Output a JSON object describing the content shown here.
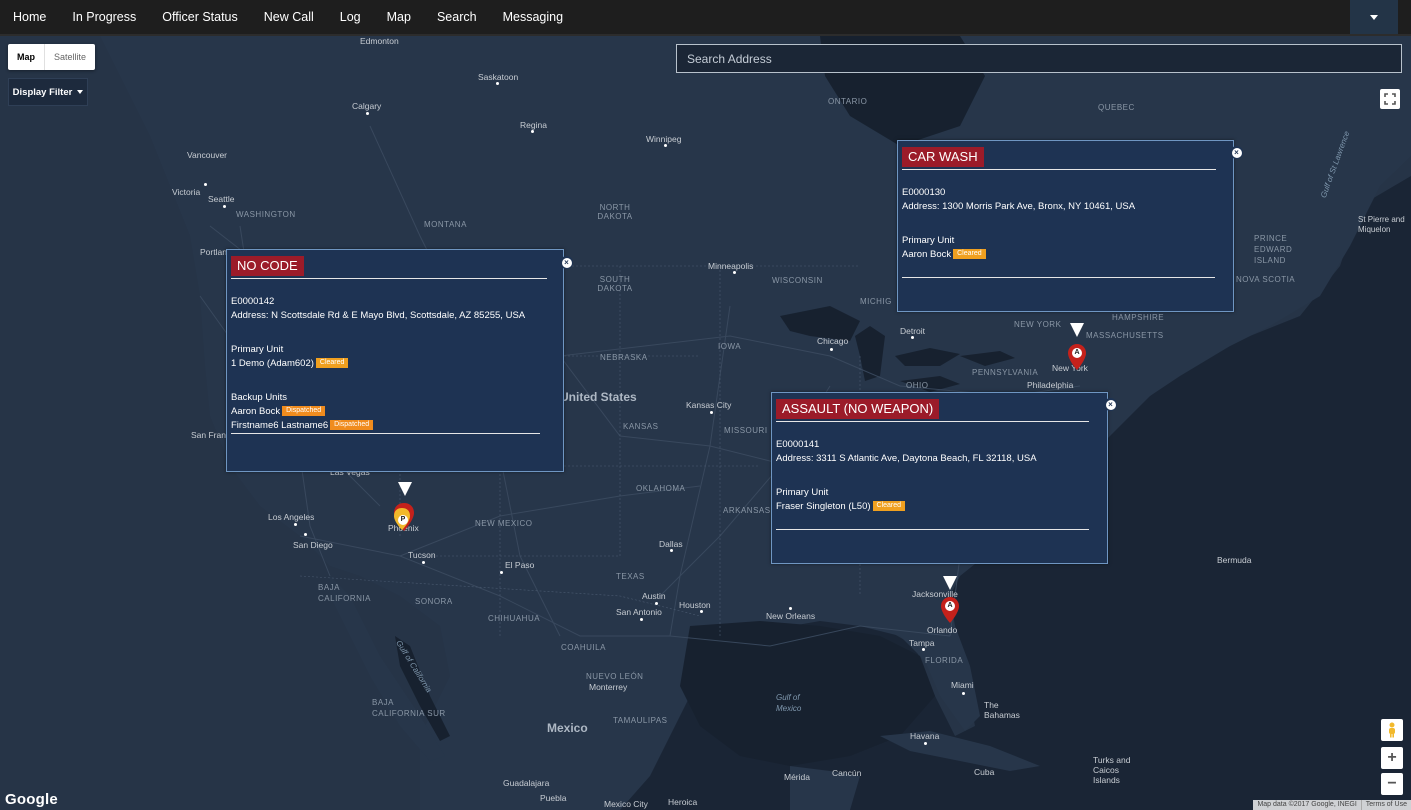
{
  "nav": {
    "items": [
      "Home",
      "In Progress",
      "Officer Status",
      "New Call",
      "Log",
      "Map",
      "Search",
      "Messaging"
    ]
  },
  "map_controls": {
    "map_type_map": "Map",
    "map_type_satellite": "Satellite",
    "display_filter": "Display Filter",
    "search_placeholder": "Search Address",
    "google_logo": "Google",
    "attribution_data": "Map data ©2017 Google, INEGI",
    "attribution_terms": "Terms of Use",
    "zoom_in": "+",
    "zoom_out": "−"
  },
  "popups": {
    "no_code": {
      "title": "NO CODE",
      "event_id": "E0000142",
      "address": "Address: N Scottsdale Rd & E Mayo Blvd, Scottsdale, AZ 85255, USA",
      "primary_label": "Primary Unit",
      "primary_unit": "1 Demo (Adam602)",
      "primary_status": "Cleared",
      "backup_label": "Backup Units",
      "backup_1": "Aaron Bock",
      "backup_1_status": "Dispatched",
      "backup_2": "Firstname6 Lastname6",
      "backup_2_status": "Dispatched"
    },
    "car_wash": {
      "title": "CAR WASH",
      "event_id": "E0000130",
      "address": "Address: 1300 Morris Park Ave, Bronx, NY 10461, USA",
      "primary_label": "Primary Unit",
      "primary_unit": "Aaron Bock",
      "primary_status": "Cleared"
    },
    "assault": {
      "title": "ASSAULT (NO WEAPON)",
      "event_id": "E0000141",
      "address": "Address: 3311 S Atlantic Ave, Daytona Beach, FL 32118, USA",
      "primary_label": "Primary Unit",
      "primary_unit": "Fraser Singleton (L50)",
      "primary_status": "Cleared"
    }
  },
  "markers": {
    "phoenix": "P",
    "new_york": "A",
    "orlando": "A"
  },
  "map_labels": {
    "edmonton": "Edmonton",
    "saskatoon": "Saskatoon",
    "calgary": "Calgary",
    "regina": "Regina",
    "winnipeg": "Winnipeg",
    "ontario": "ONTARIO",
    "quebec": "QUEBEC",
    "vancouver": "Vancouver",
    "victoria": "Victoria",
    "seattle": "Seattle",
    "washington": "WASHINGTON",
    "portland": "Portland",
    "montana": "MONTANA",
    "north_dakota": "NORTH\nDAKOTA",
    "minneapolis": "Minneapolis",
    "south_dakota": "SOUTH\nDAKOTA",
    "wisconsin": "WISCONSIN",
    "michigan": "MICHIG",
    "detroit": "Detroit",
    "chicago": "Chicago",
    "iowa": "IOWA",
    "nebraska": "NEBRASKA",
    "united_states": "United States",
    "kansas_city": "Kansas City",
    "kansas": "KANSAS",
    "missouri": "MISSOURI",
    "oklahoma": "OKLAHOMA",
    "arkansas": "ARKANSAS",
    "new_york_state": "NEW YORK",
    "new_york_city": "New York",
    "pennsylvania": "PENNSYLVANIA",
    "philadelphia": "Philadelphia",
    "ohio": "OHIO",
    "massachusetts": "MASSACHUSETTS",
    "hampshire": "HAMPSHIRE",
    "nova_scotia": "NOVA SCOTIA",
    "prince_edward": "PRINCE\nEDWARD\nISLAND",
    "st_pierre": "St Pierre and\nMiquelon",
    "gulf_st_lawrence": "Gulf of St Lawrence",
    "san_francisco": "San Fran",
    "las_vegas": "Las Vegas",
    "los_angeles": "Los Angeles",
    "san_diego": "San Diego",
    "phoenix": "Phoenix",
    "tucson": "Tucson",
    "new_mexico": "NEW MEXICO",
    "el_paso": "El Paso",
    "dallas": "Dallas",
    "texas": "TEXAS",
    "austin": "Austin",
    "houston": "Houston",
    "san_antonio": "San Antonio",
    "new_orleans": "New Orleans",
    "jacksonville": "Jacksonville",
    "orlando": "Orlando",
    "tampa": "Tampa",
    "florida": "FLORIDA",
    "miami": "Miami",
    "bermuda": "Bermuda",
    "baja_california": "BAJA\nCALIFORNIA",
    "sonora": "SONORA",
    "chihuahua": "CHIHUAHUA",
    "coahuila": "COAHUILA",
    "nuevo_leon": "NUEVO LEÓN",
    "monterrey": "Monterrey",
    "tamaulipas": "TAMAULIPAS",
    "baja_california_sur": "BAJA\nCALIFORNIA SUR",
    "gulf_california": "Gulf of California",
    "gulf_mexico": "Gulf of\nMexico",
    "mexico": "Mexico",
    "the_bahamas": "The\nBahamas",
    "havana": "Havana",
    "cuba": "Cuba",
    "turks_caicos": "Turks and\nCaicos\nIslands",
    "merida": "Mérida",
    "cancun": "Cancún",
    "guadalajara": "Guadalajara",
    "puebla": "Puebla",
    "mexico_city": "Mexico City",
    "heroica": "Heroica"
  },
  "colors": {
    "navbar": "#1e1e1e",
    "map_background": "#1b2636",
    "land": "#242f3e",
    "popup_bg": "#1e3353",
    "title_bg": "#9b1b29",
    "badge": "#f0a020",
    "marker_red": "#c4211b"
  },
  "icons": [
    "fullscreen-icon",
    "pegman-icon",
    "close-icon",
    "chevron-down-icon",
    "map-marker-icon"
  ]
}
